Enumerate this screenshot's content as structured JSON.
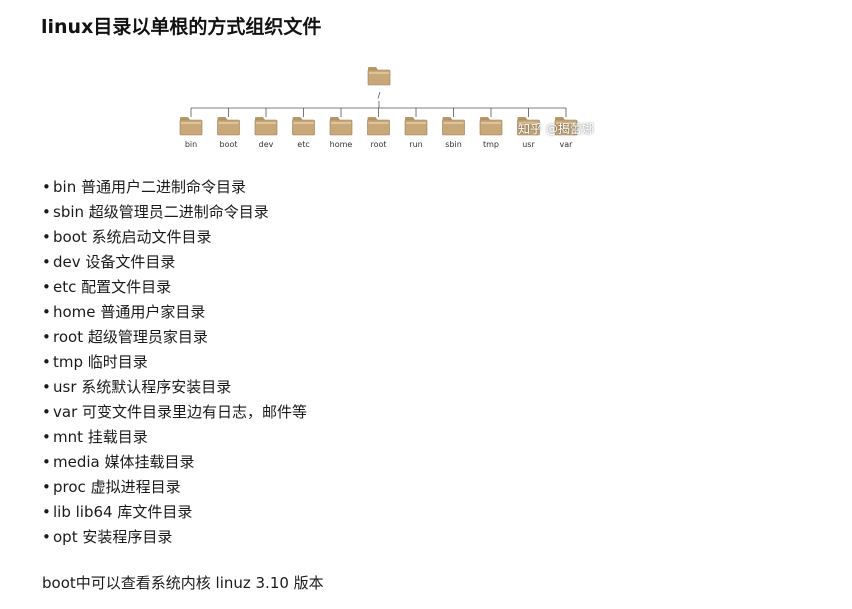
{
  "heading": "linux目录以单根的方式组织文件",
  "tree": {
    "root_label": "/",
    "folders": [
      "bin",
      "boot",
      "dev",
      "etc",
      "home",
      "root",
      "run",
      "sbin",
      "tmp",
      "usr",
      "var"
    ],
    "folder_icon": "folder-icon",
    "folder_color": "#c8a878"
  },
  "watermark": "知乎 @揭蕾娜",
  "bullet": "•",
  "items": [
    {
      "name": "bin",
      "desc": "普通用户二进制命令目录"
    },
    {
      "name": "sbin",
      "desc": "超级管理员二进制命令目录"
    },
    {
      "name": "boot",
      "desc": "系统启动文件目录"
    },
    {
      "name": "dev",
      "desc": "设备文件目录"
    },
    {
      "name": "etc",
      "desc": "配置文件目录"
    },
    {
      "name": "home",
      "desc": "普通用户家目录"
    },
    {
      "name": "root",
      "desc": "超级管理员家目录"
    },
    {
      "name": "tmp",
      "desc": "临时目录"
    },
    {
      "name": "usr",
      "desc": "系统默认程序安装目录"
    },
    {
      "name": "var",
      "desc": "可变文件目录里边有日志，邮件等"
    },
    {
      "name": "mnt",
      "desc": "挂载目录"
    },
    {
      "name": "media",
      "desc": "媒体挂载目录"
    },
    {
      "name": "proc",
      "desc": "虚拟进程目录"
    },
    {
      "name": "lib lib64",
      "desc": "库文件目录"
    },
    {
      "name": "opt",
      "desc": "安装程序目录"
    }
  ],
  "footer": "boot中可以查看系统内核 linuz 3.10 版本"
}
